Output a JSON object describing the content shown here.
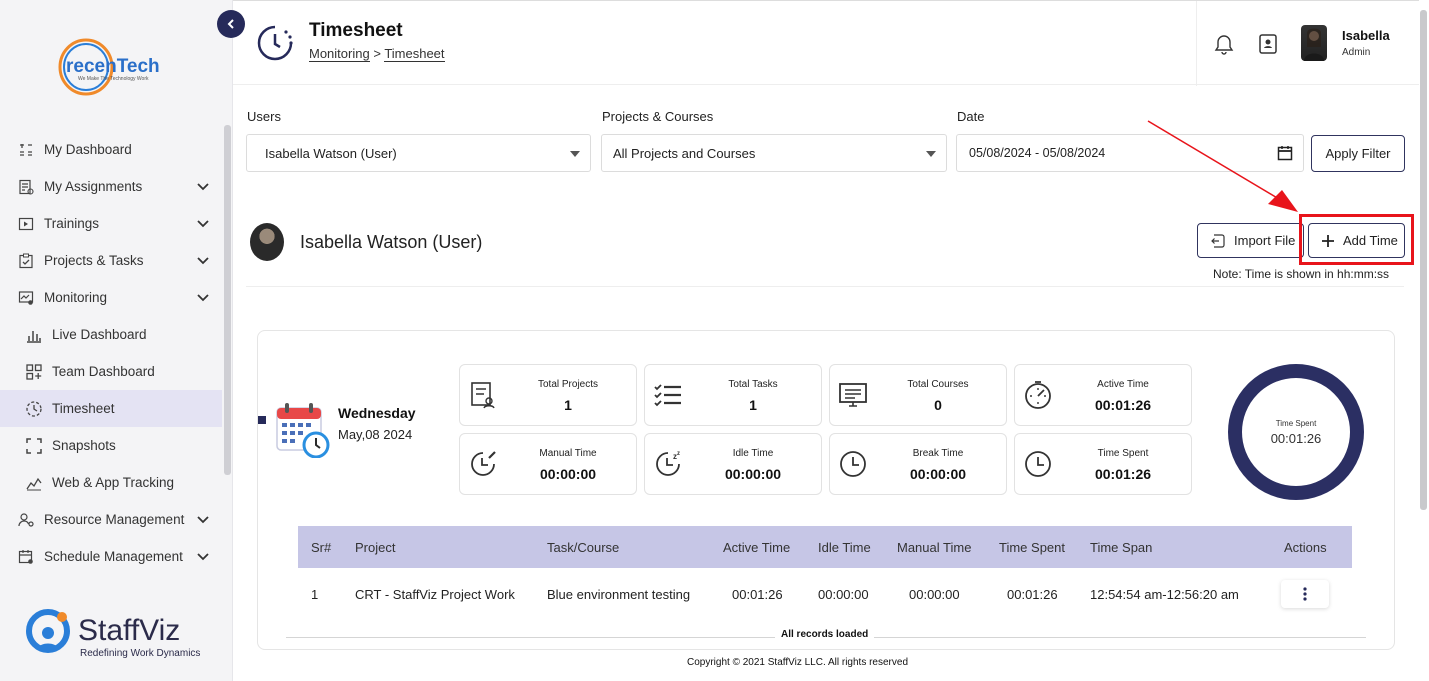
{
  "brand": {
    "logo_text": "recenTech",
    "logo_tagline": "We Make The Technology Work",
    "footer_logo_name": "StaffViz",
    "footer_logo_tagline": "Redefining Work Dynamics"
  },
  "sidebar": {
    "items": [
      {
        "label": "My Dashboard",
        "icon": "dashboard-icon",
        "expandable": false
      },
      {
        "label": "My Assignments",
        "icon": "assignments-icon",
        "expandable": true
      },
      {
        "label": "Trainings",
        "icon": "play-icon",
        "expandable": true
      },
      {
        "label": "Projects & Tasks",
        "icon": "clipboard-icon",
        "expandable": true
      },
      {
        "label": "Monitoring",
        "icon": "monitor-icon",
        "expandable": true
      }
    ],
    "sub_items": [
      {
        "label": "Live Dashboard",
        "icon": "bar-chart-icon"
      },
      {
        "label": "Team Dashboard",
        "icon": "grid-plus-icon"
      },
      {
        "label": "Timesheet",
        "icon": "clock-icon",
        "active": true
      },
      {
        "label": "Snapshots",
        "icon": "frame-icon"
      },
      {
        "label": "Web & App Tracking",
        "icon": "line-chart-icon"
      }
    ],
    "bottom_items": [
      {
        "label": "Resource Management",
        "icon": "users-gear-icon",
        "expandable": true
      },
      {
        "label": "Schedule Management",
        "icon": "schedule-icon",
        "expandable": true
      }
    ]
  },
  "header": {
    "title": "Timesheet",
    "breadcrumb_1": "Monitoring",
    "breadcrumb_sep": ">",
    "breadcrumb_2": "Timesheet",
    "user_name": "Isabella",
    "user_role": "Admin"
  },
  "filters": {
    "users_label": "Users",
    "users_value": "Isabella Watson (User)",
    "projects_label": "Projects & Courses",
    "projects_value": "All Projects and Courses",
    "date_label": "Date",
    "date_value": "05/08/2024 - 05/08/2024",
    "apply_label": "Apply Filter"
  },
  "user_section": {
    "name": "Isabella Watson (User)",
    "import_label": "Import File",
    "add_time_label": "Add Time",
    "note": "Note: Time is shown in hh:mm:ss"
  },
  "day": {
    "weekday": "Wednesday",
    "date": "May,08 2024"
  },
  "stats": [
    {
      "label": "Total Projects",
      "value": "1",
      "icon": "projects-icon"
    },
    {
      "label": "Total Tasks",
      "value": "1",
      "icon": "tasks-icon"
    },
    {
      "label": "Total Courses",
      "value": "0",
      "icon": "courses-icon"
    },
    {
      "label": "Active Time",
      "value": "00:01:26",
      "icon": "stopwatch-icon"
    },
    {
      "label": "Manual Time",
      "value": "00:00:00",
      "icon": "manual-clock-icon"
    },
    {
      "label": "Idle Time",
      "value": "00:00:00",
      "icon": "idle-clock-icon"
    },
    {
      "label": "Break Time",
      "value": "00:00:00",
      "icon": "break-clock-icon"
    },
    {
      "label": "Time Spent",
      "value": "00:01:26",
      "icon": "time-spent-icon"
    }
  ],
  "donut": {
    "label": "Time Spent",
    "value": "00:01:26",
    "color": "#2b2f63"
  },
  "table": {
    "headers": [
      "Sr#",
      "Project",
      "Task/Course",
      "Active Time",
      "Idle Time",
      "Manual Time",
      "Time Spent",
      "Time Span",
      "Actions"
    ],
    "rows": [
      [
        "1",
        "CRT - StaffViz Project Work",
        "Blue environment testing",
        "00:01:26",
        "00:00:00",
        "00:00:00",
        "00:01:26",
        "12:54:54 am-12:56:20 am"
      ]
    ],
    "all_loaded": "All records loaded"
  },
  "footer": {
    "copyright": "Copyright © 2021 StaffViz LLC. All rights reserved"
  },
  "colors": {
    "accent": "#262a5a",
    "table_header": "#c6c6e6",
    "highlight": "#e8141b",
    "active_nav": "#e4e3f3"
  }
}
